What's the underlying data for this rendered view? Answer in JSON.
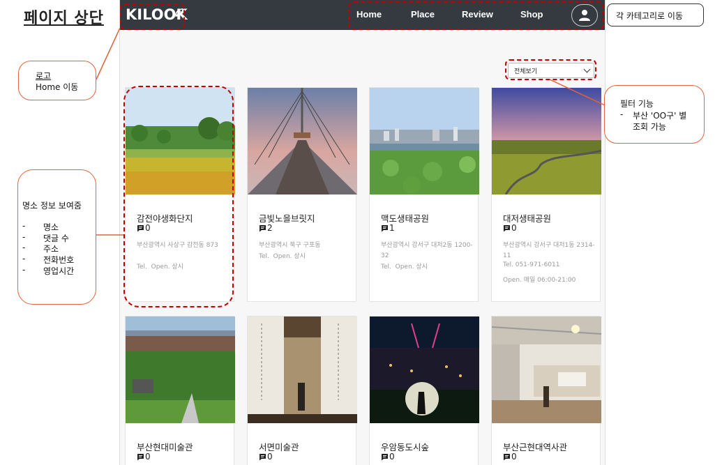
{
  "page_title": "페이지 상단",
  "navbar": {
    "logo_text": "KILOOK",
    "links": [
      "Home",
      "Place",
      "Review",
      "Shop"
    ],
    "user_icon": "user-icon"
  },
  "filter": {
    "selected": "전체보기"
  },
  "places": [
    {
      "name": "감전야생화단지",
      "comments": "0",
      "address": "부산광역시 사상구 감전동 873",
      "tel": "Tel.",
      "open": "Open. 상시",
      "tel_open_inline": true
    },
    {
      "name": "금빛노을브릿지",
      "comments": "2",
      "address": "부산광역시 북구 구포동",
      "tel": "Tel.",
      "open": "Open. 상시",
      "tel_open_inline": true
    },
    {
      "name": "맥도생태공원",
      "comments": "1",
      "address": "부산광역시 강서구 대저2동 1200-32",
      "tel": "Tel.",
      "open": "Open. 상시",
      "tel_open_inline": true
    },
    {
      "name": "대저생태공원",
      "comments": "0",
      "address": "부산광역시 강서구 대저1동 2314-11",
      "tel": "Tel. 051-971-6011",
      "open": "Open. 매일 06:00-21:00",
      "tel_open_inline": false
    },
    {
      "name": "부산현대미술관",
      "comments": "0"
    },
    {
      "name": "서면미술관",
      "comments": "0"
    },
    {
      "name": "우암동도시숲",
      "comments": "0"
    },
    {
      "name": "부산근현대역사관",
      "comments": "0"
    }
  ],
  "annotations": {
    "logo": {
      "title": "로고",
      "desc": "Home 이동"
    },
    "category": "각 카테고리로 이동",
    "filter": {
      "title": "필터 기능",
      "bullet": "-",
      "line1": "부산 'OO구' 별",
      "line2": "조회 가능"
    },
    "place_info": {
      "title": "명소 정보 보여줌",
      "bullets": [
        "명소",
        "댓글 수",
        "주소",
        "전화번호",
        "영업시간"
      ]
    }
  },
  "colors": {
    "navbar": "#343a40",
    "annotation_dash": "#c00000",
    "callout_border": "#e0643a"
  }
}
